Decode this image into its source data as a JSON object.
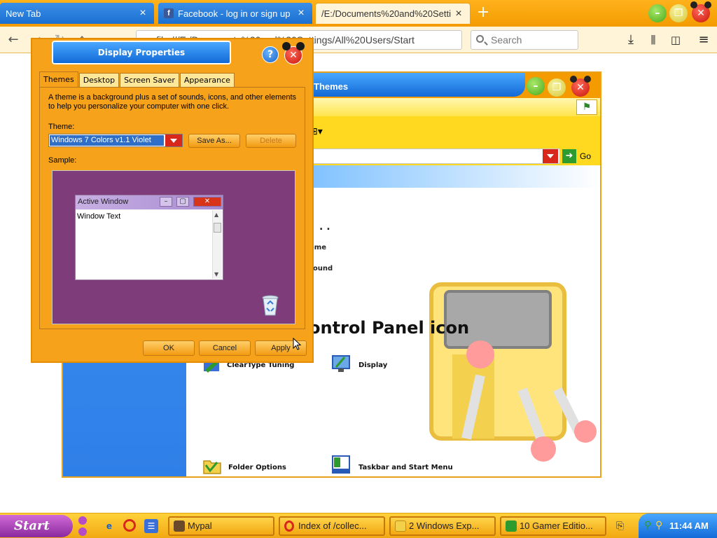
{
  "browser": {
    "tabs": [
      {
        "label": "New Tab",
        "active": false
      },
      {
        "label": "Facebook - log in or sign up",
        "active": false
      },
      {
        "label": "/E:/Documents%20and%20Setti",
        "active": true
      }
    ],
    "url": "file:///E:/Documents%20and%20Settings/All%20Users/Start",
    "search_placeholder": "Search"
  },
  "explorer": {
    "title": "Themes",
    "address_go": "Go",
    "content": {
      "dots": ". .",
      "line_theme": "eme",
      "line_background": "round",
      "heading": "ontrol Panel icon",
      "items": [
        {
          "label": "ClearType Tuning"
        },
        {
          "label": "Display"
        },
        {
          "label": "Folder Options"
        },
        {
          "label": "Taskbar and Start Menu"
        }
      ]
    }
  },
  "dialog": {
    "title": "Display Properties",
    "tabs": [
      "Themes",
      "Desktop",
      "Screen Saver",
      "Appearance"
    ],
    "intro": "A theme is a background plus a set of sounds, icons, and other elements to help you personalize your computer with one click.",
    "theme_label": "Theme:",
    "theme_value": "Windows 7 Colors v1.1 Violet",
    "save_as": "Save As...",
    "delete": "Delete",
    "sample_label": "Sample:",
    "sample_window_title": "Active Window",
    "sample_window_text": "Window Text",
    "ok": "OK",
    "cancel": "Cancel",
    "apply": "Apply"
  },
  "taskbar": {
    "start": "Start",
    "tasks": [
      {
        "label": "Mypal"
      },
      {
        "label": "Index of /collec..."
      },
      {
        "label": "2 Windows Exp..."
      },
      {
        "label": "10 Gamer Editio..."
      }
    ],
    "clock": "11:44 AM"
  },
  "colors": {
    "accent_orange": "#f39b00",
    "title_blue": "#1169d6",
    "sample_violet": "#7e3c7a",
    "close_red": "#d8281c"
  }
}
